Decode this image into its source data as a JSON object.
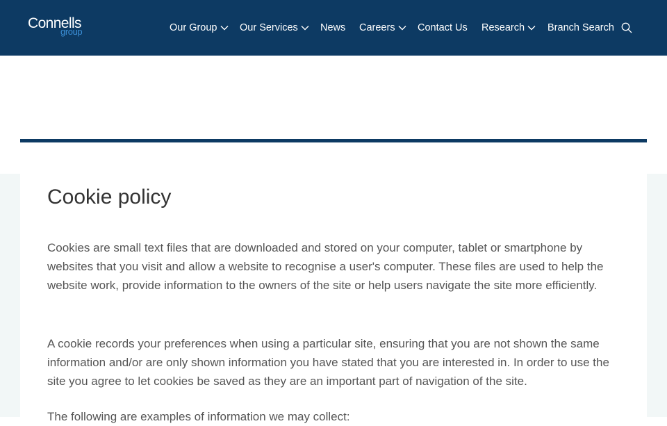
{
  "brand": {
    "name_main": "Connells",
    "name_sub": "group"
  },
  "nav": {
    "items": [
      {
        "label": "Our Group",
        "has_dropdown": true
      },
      {
        "label": "Our Services",
        "has_dropdown": true
      },
      {
        "label": "News",
        "has_dropdown": false
      },
      {
        "label": "Careers",
        "has_dropdown": true
      },
      {
        "label": "Contact Us",
        "has_dropdown": false
      },
      {
        "label": "Research",
        "has_dropdown": true
      },
      {
        "label": "Branch Search",
        "has_dropdown": false
      }
    ],
    "search_icon": "search-icon"
  },
  "content": {
    "title": "Cookie policy",
    "paragraphs": [
      "Cookies are small text files that are downloaded and stored on your computer, tablet or smartphone by websites that you visit and allow a website to recognise a user's computer. These files are used to help the website work, provide information to the owners of the site or help users navigate the site more efficiently.",
      "A cookie records your preferences when using a particular site, ensuring that you are not shown the same information and/or are only shown information you have stated that you are interested in. In order to use the site you agree to let cookies be saved as they are an important part of navigation of the site.",
      "The following are examples of information we may collect:"
    ]
  },
  "colors": {
    "header_bg": "#0d3a63",
    "accent_blue": "#3b8fd6",
    "page_bg": "#f2f7f7",
    "text": "#555555"
  }
}
